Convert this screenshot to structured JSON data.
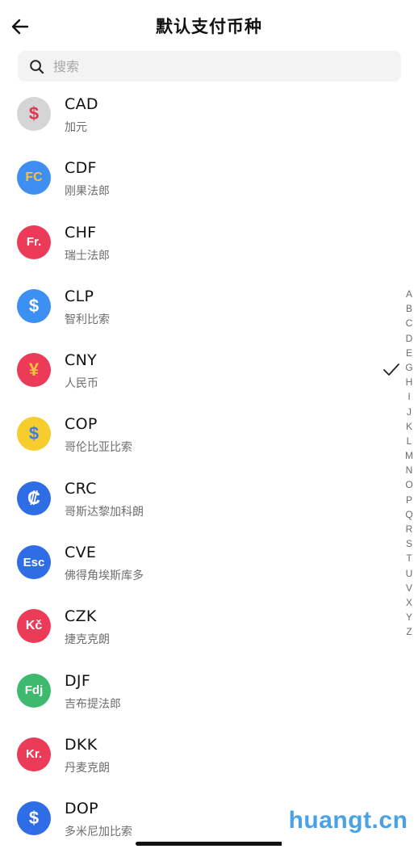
{
  "header": {
    "title": "默认支付币种",
    "back_icon": "back-arrow-icon"
  },
  "search": {
    "placeholder": "搜索",
    "value": ""
  },
  "currencies": [
    {
      "code": "CAD",
      "name": "加元",
      "symbol": "$",
      "color": "#d5d5d5",
      "symbol_color": "#e0344f"
    },
    {
      "code": "CDF",
      "name": "刚果法郎",
      "symbol": "FC",
      "color": "#3f8ef1",
      "symbol_color": "#f5c43a"
    },
    {
      "code": "CHF",
      "name": "瑞士法郎",
      "symbol": "Fr.",
      "color": "#ec3b58",
      "symbol_color": "#ffffff"
    },
    {
      "code": "CLP",
      "name": "智利比索",
      "symbol": "$",
      "color": "#3c8ff3",
      "symbol_color": "#ffffff"
    },
    {
      "code": "CNY",
      "name": "人民币",
      "symbol": "¥",
      "color": "#ec3b58",
      "symbol_color": "#f5c43a",
      "selected": true
    },
    {
      "code": "COP",
      "name": "哥伦比亚比索",
      "symbol": "$",
      "color": "#f6cd2c",
      "symbol_color": "#3f7be9"
    },
    {
      "code": "CRC",
      "name": "哥斯达黎加科朗",
      "symbol": "₡",
      "color": "#2f6de6",
      "symbol_color": "#ffffff"
    },
    {
      "code": "CVE",
      "name": "佛得角埃斯库多",
      "symbol": "Esc",
      "color": "#2f6de6",
      "symbol_color": "#ffffff"
    },
    {
      "code": "CZK",
      "name": "捷克克朗",
      "symbol": "Kč",
      "color": "#ec3b58",
      "symbol_color": "#ffffff"
    },
    {
      "code": "DJF",
      "name": "吉布提法郎",
      "symbol": "Fdj",
      "color": "#3dba6e",
      "symbol_color": "#ffffff"
    },
    {
      "code": "DKK",
      "name": "丹麦克朗",
      "symbol": "Kr.",
      "color": "#ec3b58",
      "symbol_color": "#ffffff"
    },
    {
      "code": "DOP",
      "name": "多米尼加比索",
      "symbol": "$",
      "color": "#2f6de6",
      "symbol_color": "#ffffff"
    }
  ],
  "selected_icon": "checkmark-icon",
  "index_letters": [
    "A",
    "B",
    "C",
    "D",
    "E",
    "G",
    "H",
    "I",
    "J",
    "K",
    "L",
    "M",
    "N",
    "O",
    "P",
    "Q",
    "R",
    "S",
    "T",
    "U",
    "V",
    "X",
    "Y",
    "Z"
  ],
  "watermark": "huangt.cn",
  "colors": {
    "accent": "#47a3e6",
    "text": "#111111",
    "subtext": "#6e6e6e",
    "search_bg": "#f3f3f3"
  }
}
